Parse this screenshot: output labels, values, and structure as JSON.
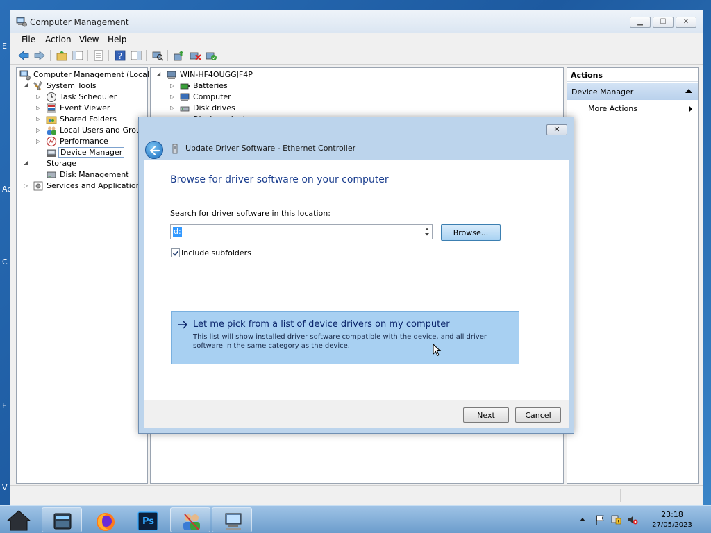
{
  "desktop": {
    "edge_labels": [
      "E",
      "Ac",
      "C",
      "F",
      "V"
    ]
  },
  "window": {
    "title": "Computer Management",
    "menu": [
      "File",
      "Action",
      "View",
      "Help"
    ],
    "tree": [
      {
        "label": "Computer Management (Local)",
        "icon": "computer-management-icon"
      },
      {
        "label": "System Tools",
        "icon": "tools-icon"
      },
      {
        "label": "Task Scheduler",
        "icon": "clock-icon"
      },
      {
        "label": "Event Viewer",
        "icon": "event-viewer-icon"
      },
      {
        "label": "Shared Folders",
        "icon": "shared-folder-icon"
      },
      {
        "label": "Local Users and Groups",
        "icon": "users-icon"
      },
      {
        "label": "Performance",
        "icon": "performance-icon"
      },
      {
        "label": "Device Manager",
        "icon": "device-manager-icon"
      },
      {
        "label": "Storage",
        "icon": "storage-icon"
      },
      {
        "label": "Disk Management",
        "icon": "disk-icon"
      },
      {
        "label": "Services and Applications",
        "icon": "services-icon"
      }
    ],
    "devices": {
      "root": "WIN-HF4OUGGJF4P",
      "items": [
        "Batteries",
        "Computer",
        "Disk drives",
        "Display adapters"
      ]
    },
    "actions": {
      "header": "Actions",
      "section": "Device Manager",
      "more": "More Actions"
    }
  },
  "dialog": {
    "title": "Update Driver Software - Ethernet Controller",
    "close_glyph": "✕",
    "heading": "Browse for driver software on your computer",
    "search_label": "Search for driver software in this location:",
    "path_value": "d:",
    "browse_label": "Browse...",
    "include_subfolders_label": "Include subfolders",
    "include_subfolders_checked": true,
    "pick_title": "Let me pick from a list of device drivers on my computer",
    "pick_desc": "This list will show installed driver software compatible with the device, and all driver software in the same category as the device.",
    "next_label": "Next",
    "cancel_label": "Cancel"
  },
  "taskbar": {
    "apps": [
      "home-icon",
      "file-manager-icon",
      "firefox-icon",
      "photoshop-icon",
      "users-app-icon",
      "computer-management-app-icon"
    ],
    "photoshop_label": "Ps",
    "time": "23:18",
    "date": "27/05/2023"
  },
  "colors": {
    "accent": "#1c3f8f",
    "dialog_frame": "#bcd4ec",
    "option_highlight": "#a8d0f2"
  }
}
